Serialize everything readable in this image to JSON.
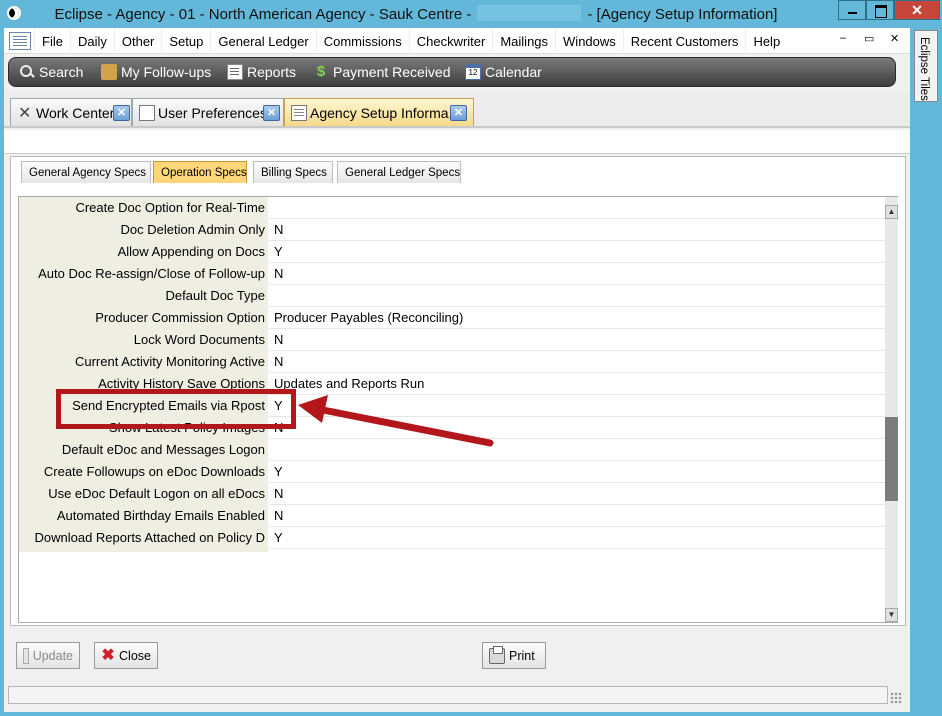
{
  "window": {
    "title_before": "Eclipse - Agency - 01 - North American Agency - Sauk Centre -",
    "title_after": "- [Agency Setup Information]"
  },
  "menu": {
    "items": [
      "File",
      "Daily",
      "Other",
      "Setup",
      "General Ledger",
      "Commissions",
      "Checkwriter",
      "Mailings",
      "Windows",
      "Recent Customers",
      "Help"
    ],
    "controls": {
      "minimize": "–",
      "restore": "▭",
      "close": "✕"
    }
  },
  "toolbar": {
    "items": [
      {
        "label": "Search",
        "icon": "search-icon"
      },
      {
        "label": "My Follow-ups",
        "icon": "followup-icon"
      },
      {
        "label": "Reports",
        "icon": "reports-icon"
      },
      {
        "label": "Payment Received",
        "icon": "payment-icon"
      },
      {
        "label": "Calendar",
        "icon": "calendar-icon"
      }
    ],
    "calendar_day": "12",
    "payment_glyph": "$"
  },
  "doc_tabs": [
    {
      "label": "Work Center",
      "active": false
    },
    {
      "label": "User Preferences",
      "active": false
    },
    {
      "label": "Agency Setup Informa...",
      "active": true
    }
  ],
  "tab_close_glyph": "✕",
  "sub_tabs": [
    "General Agency Specs",
    "Operation Specs",
    "Billing Specs",
    "General Ledger Specs"
  ],
  "active_sub_tab": "Operation Specs",
  "grid": {
    "rows": [
      {
        "label": "Create Doc Option for Real-Time",
        "value": ""
      },
      {
        "label": "Doc Deletion Admin Only",
        "value": "N"
      },
      {
        "label": "Allow Appending on Docs",
        "value": "Y"
      },
      {
        "label": "Auto Doc Re-assign/Close of Follow-up",
        "value": "N"
      },
      {
        "label": "Default Doc Type",
        "value": ""
      },
      {
        "label": "Producer Commission Option",
        "value": "Producer Payables (Reconciling)"
      },
      {
        "label": "Lock Word Documents",
        "value": "N"
      },
      {
        "label": "Current Activity Monitoring Active",
        "value": "N"
      },
      {
        "label": "Activity History Save Options",
        "value": "Updates and Reports Run"
      },
      {
        "label": "Send Encrypted Emails via Rpost",
        "value": "Y"
      },
      {
        "label": "Show Latest Policy Images",
        "value": "N"
      },
      {
        "label": "Default eDoc and Messages Logon",
        "value": ""
      },
      {
        "label": "Create Followups on eDoc Downloads",
        "value": "Y"
      },
      {
        "label": "Use eDoc Default Logon on all eDocs",
        "value": "N"
      },
      {
        "label": "Automated Birthday Emails Enabled",
        "value": "N"
      },
      {
        "label": "Download Reports Attached on Policy D",
        "value": "Y"
      }
    ]
  },
  "buttons": {
    "update": "Update",
    "close": "Close",
    "print": "Print"
  },
  "side_panel": {
    "label": "Eclipse Tiles"
  },
  "colors": {
    "highlight": "#b3161b",
    "title_bar": "#63b7d9"
  }
}
